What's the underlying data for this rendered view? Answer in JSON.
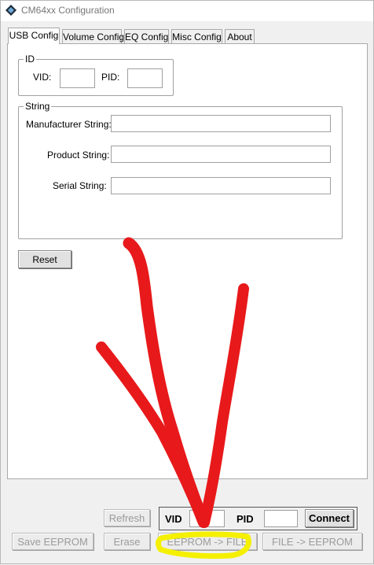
{
  "window": {
    "title": "CM64xx Configuration"
  },
  "tabs": [
    {
      "label": "USB Config",
      "active": true
    },
    {
      "label": "Volume Config",
      "active": false
    },
    {
      "label": "EQ Config",
      "active": false
    },
    {
      "label": "Misc Config",
      "active": false
    },
    {
      "label": "About",
      "active": false
    }
  ],
  "id_group": {
    "legend": "ID",
    "vid_label": "VID:",
    "vid_value": "",
    "pid_label": "PID:",
    "pid_value": ""
  },
  "string_group": {
    "legend": "String",
    "manufacturer_label": "Manufacturer String:",
    "manufacturer_value": "",
    "product_label": "Product String:",
    "product_value": "",
    "serial_label": "Serial String:",
    "serial_value": ""
  },
  "reset_label": "Reset",
  "bottom": {
    "refresh_label": "Refresh",
    "vid_label": "VID",
    "vid_value": "",
    "pid_label": "PID",
    "pid_value": "",
    "connect_label": "Connect",
    "save_eeprom_label": "Save EEPROM",
    "erase_label": "Erase",
    "eeprom_to_file_label": "EEPROM -> FILE",
    "file_to_eeprom_label": "FILE -> EEPROM"
  },
  "annotation": {
    "arrow_color": "#e8191b",
    "highlight_color": "#f4f000"
  }
}
